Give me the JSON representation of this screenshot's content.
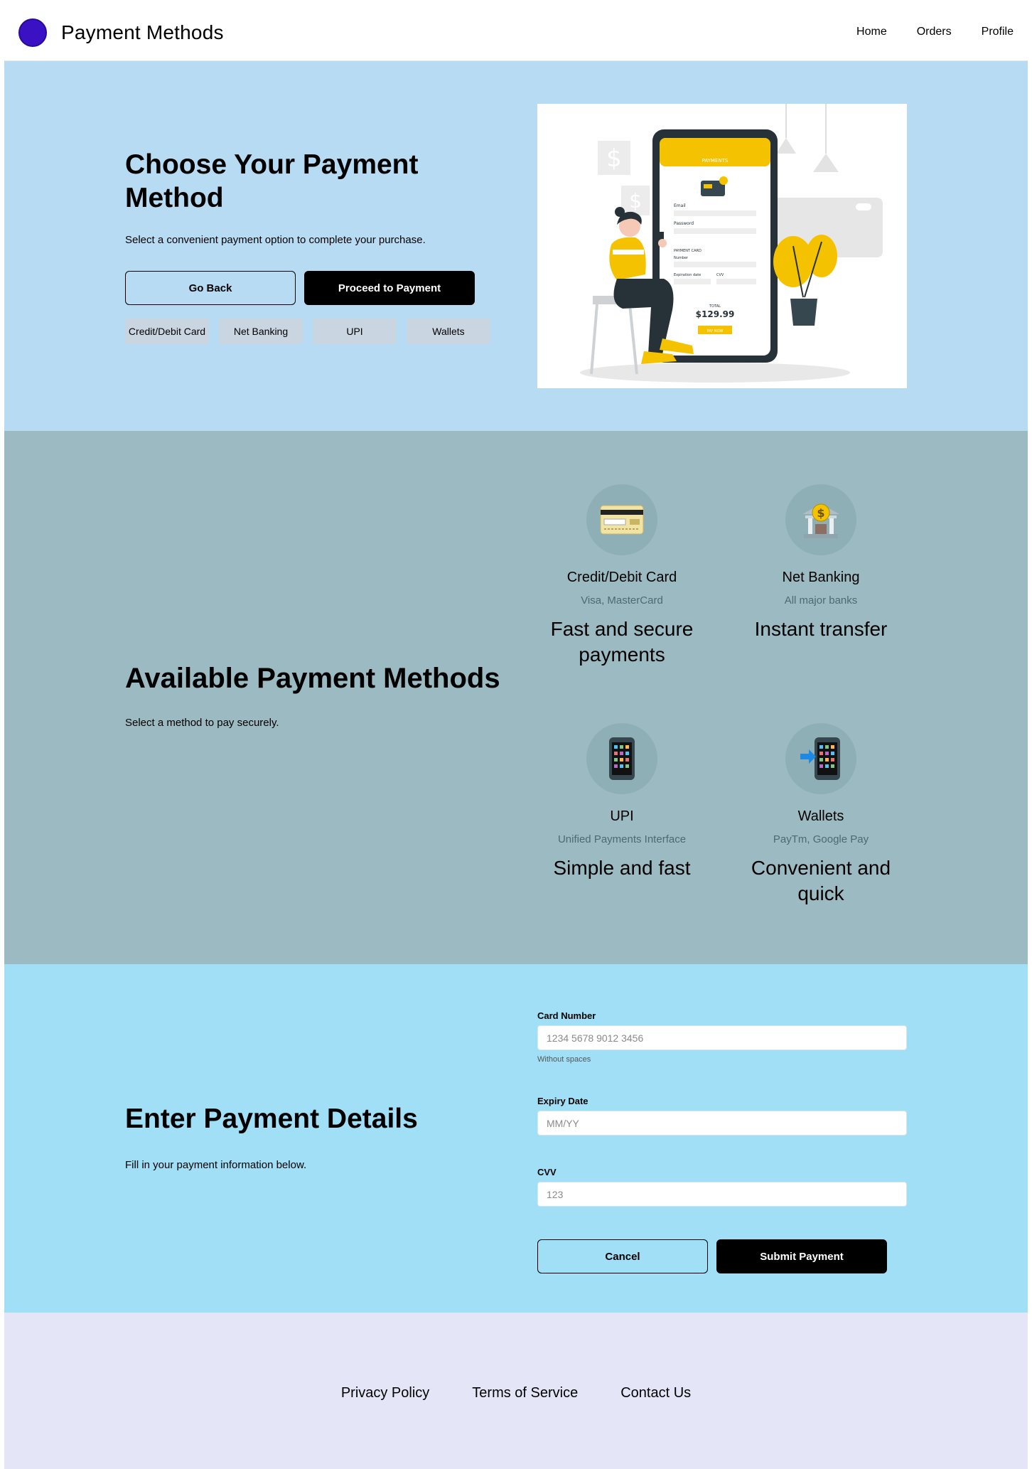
{
  "header": {
    "title": "Payment Methods",
    "logo_color": "#3a12c4",
    "nav": [
      "Home",
      "Orders",
      "Profile"
    ]
  },
  "hero": {
    "title": "Choose Your Payment Method",
    "subtitle": "Select a convenient payment option to complete your purchase.",
    "back_label": "Go Back",
    "proceed_label": "Proceed to Payment",
    "chips": [
      "Credit/Debit Card",
      "Net Banking",
      "UPI",
      "Wallets"
    ],
    "illustration": {
      "screen_title": "PAYMENTS",
      "email_label": "Email",
      "password_label": "Password",
      "card_section": "PAYMENT CARD",
      "number_label": "Number",
      "expiry_label": "Expiration date",
      "cvv_label": "CVV",
      "total_label": "TOTAL",
      "total_value": "$129.99",
      "pay_button": "PAY NOW"
    }
  },
  "methods": {
    "title": "Available Payment Methods",
    "subtitle": "Select a method to pay securely.",
    "items": [
      {
        "name": "Credit/Debit Card",
        "detail": "Visa, MasterCard",
        "tagline": "Fast and secure payments",
        "icon": "credit-card-icon"
      },
      {
        "name": "Net Banking",
        "detail": "All major banks",
        "tagline": "Instant transfer",
        "icon": "bank-icon"
      },
      {
        "name": "UPI",
        "detail": "Unified Payments Interface",
        "tagline": "Simple and fast",
        "icon": "mobile-phone-icon"
      },
      {
        "name": "Wallets",
        "detail": "PayTm, Google Pay",
        "tagline": "Convenient and quick",
        "icon": "phone-arrow-icon"
      }
    ]
  },
  "details": {
    "title": "Enter Payment Details",
    "subtitle": "Fill in your payment information below.",
    "card_number_label": "Card Number",
    "card_number_placeholder": "1234 5678 9012 3456",
    "card_number_hint": "Without spaces",
    "expiry_label": "Expiry Date",
    "expiry_placeholder": "MM/YY",
    "cvv_label": "CVV",
    "cvv_placeholder": "123",
    "cancel_label": "Cancel",
    "submit_label": "Submit Payment"
  },
  "footer": {
    "links": [
      "Privacy Policy",
      "Terms of Service",
      "Contact Us"
    ]
  },
  "colors": {
    "hero_bg": "#b8dbf4",
    "methods_bg": "#9bbac1",
    "details_bg": "#a0dff6",
    "footer_bg": "#e4e6f8",
    "accent_yellow": "#f5c200"
  }
}
